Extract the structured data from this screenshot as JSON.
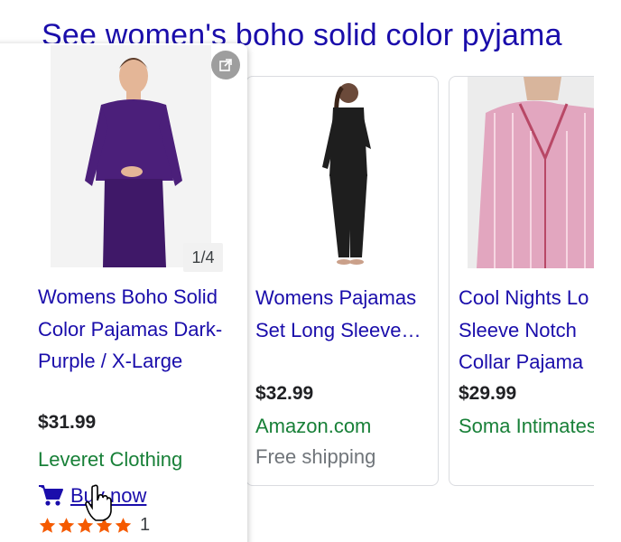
{
  "section": {
    "heading": "See women's boho solid color pyjama"
  },
  "products": [
    {
      "title": "Womens Boho Solid Color Pajamas Dark-Purple / X-Large",
      "price": "$31.99",
      "seller": "Leveret Clothing",
      "image_counter": "1/4",
      "buy_label": "Buy now",
      "rating_stars": 5,
      "rating_count": "1",
      "image_color": "#4b1f7a"
    },
    {
      "title": "Womens Pajamas Set Long Sleeve…",
      "price": "$32.99",
      "seller": "Amazon.com",
      "shipping": "Free shipping",
      "image_color": "#1e1e1e"
    },
    {
      "title": "Cool Nights Long Sleeve Notch Collar Pajama Set",
      "title_lines": [
        "Cool Nights Lo",
        "Sleeve Notch",
        "Collar Pajama"
      ],
      "price": "$29.99",
      "seller": "Soma Intimates",
      "image_color": "#e2a6bf"
    }
  ],
  "colors": {
    "link": "#1a0dab",
    "seller": "#188038",
    "star": "#f55a00",
    "price": "#202124"
  },
  "icons": [
    "external-link-icon",
    "shopping-cart-icon",
    "star-icon",
    "hand-pointer-icon"
  ]
}
